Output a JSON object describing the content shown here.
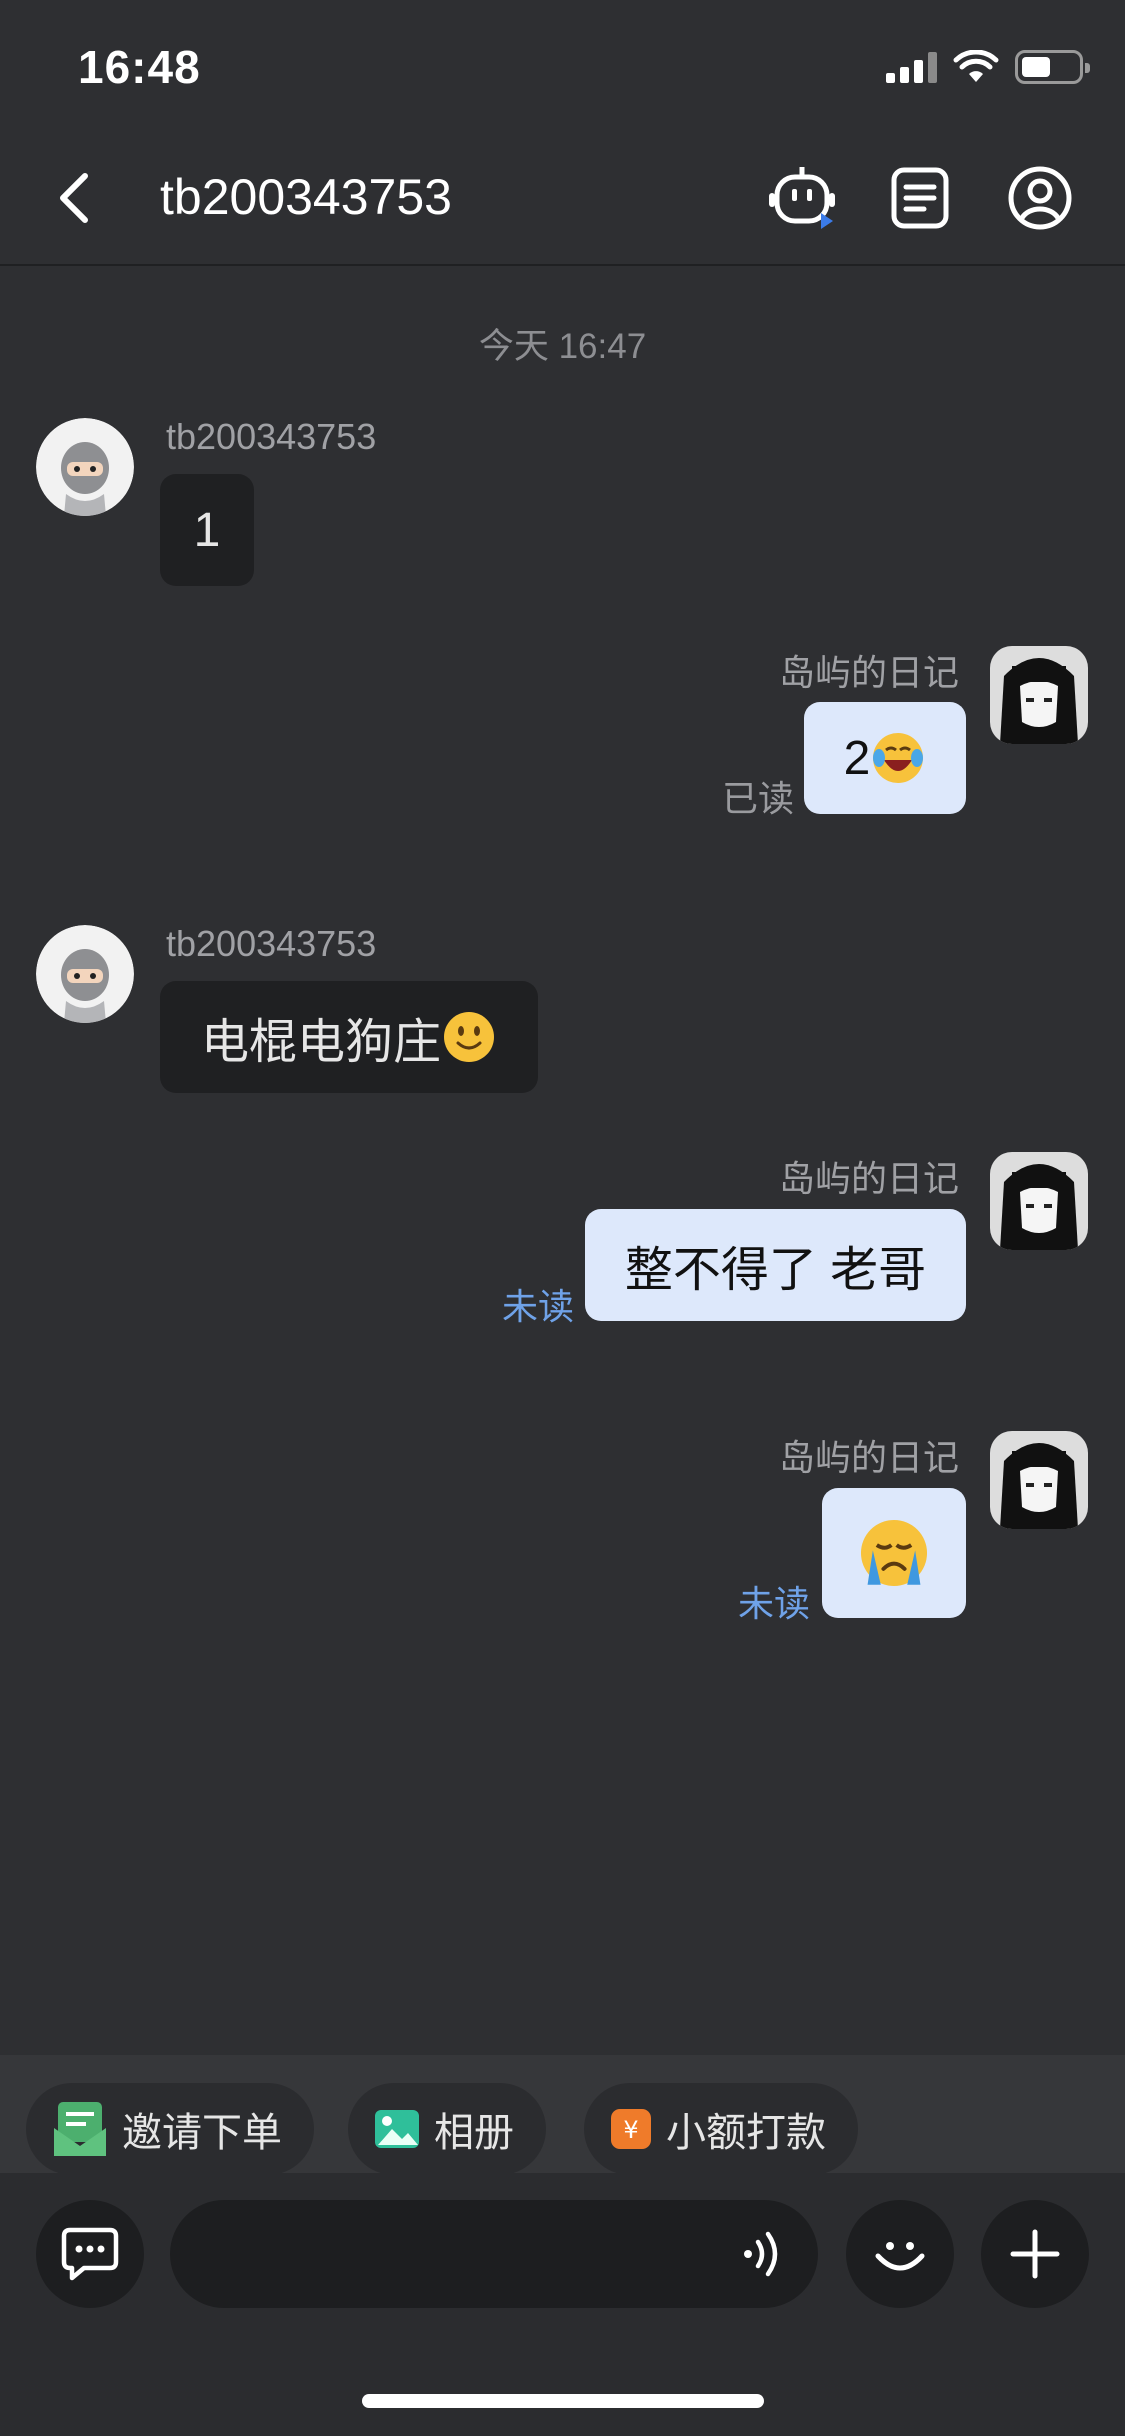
{
  "status_bar": {
    "time": "16:48"
  },
  "nav": {
    "title": "tb200343753"
  },
  "chat": {
    "time_divider": "今天 16:47",
    "messages": [
      {
        "sender": "tb200343753",
        "text": "1",
        "direction": "in"
      },
      {
        "sender": "岛屿的日记",
        "text": "2",
        "emoji": "face-with-tears-of-joy-emoji",
        "direction": "out",
        "status": "已读"
      },
      {
        "sender": "tb200343753",
        "text": "电棍电狗庄",
        "emoji": "slightly-smiling-face-emoji",
        "direction": "in"
      },
      {
        "sender": "岛屿的日记",
        "text": "整不得了 老哥",
        "direction": "out",
        "status": "未读"
      },
      {
        "sender": "岛屿的日记",
        "text": "",
        "emoji": "crying-face-emoji",
        "direction": "out",
        "status": "未读"
      }
    ]
  },
  "quick_actions": [
    {
      "label": "邀请下单",
      "icon": "invite-order-icon",
      "color": "#4caf6e"
    },
    {
      "label": "相册",
      "icon": "album-icon",
      "color": "#2fbf9a"
    },
    {
      "label": "小额打款",
      "icon": "small-payment-icon",
      "color": "#ef7b2a"
    }
  ],
  "input": {
    "placeholder": ""
  },
  "colors": {
    "background": "#2e2f32",
    "bubble_in": "#1f2022",
    "bubble_out": "#dde8fb",
    "unread": "#6fa2e8"
  }
}
